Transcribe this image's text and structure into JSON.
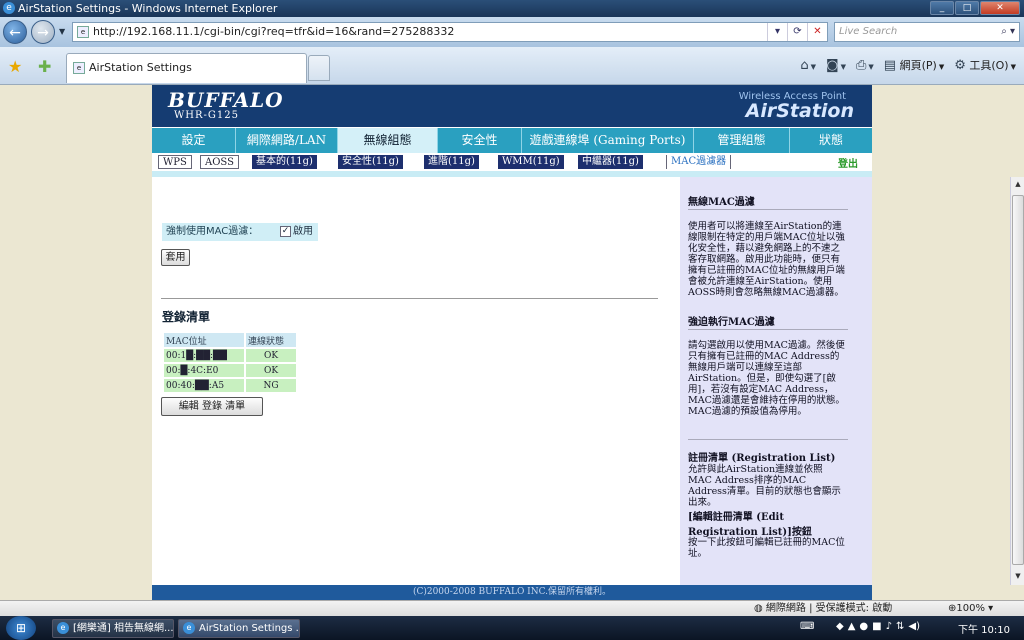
{
  "window": {
    "title": "AirStation Settings - Windows Internet Explorer"
  },
  "address": {
    "url": "http://192.168.11.1/cgi-bin/cgi?req=tfr&id=16&rand=275288332",
    "search_placeholder": "Live Search"
  },
  "tab": {
    "label": "AirStation Settings"
  },
  "cmd": {
    "page": "網頁(P)",
    "tools": "工具(O)"
  },
  "brand": {
    "logo": "BUFFALO",
    "model": "WHR-G125",
    "subtitle": "Wireless Access Point",
    "product": "AirStation"
  },
  "mainnav": [
    "設定",
    "網際網路/LAN",
    "無線組態",
    "安全性",
    "遊戲連線埠 (Gaming Ports)",
    "管理組態",
    "狀態"
  ],
  "subnav": [
    "WPS",
    "AOSS",
    "基本的(11g)",
    "安全性(11g)",
    "進階(11g)",
    "WMM(11g)",
    "中繼器(11g)",
    "MAC過濾器"
  ],
  "logout": "登出",
  "enforce": {
    "label": "強制使用MAC過濾：",
    "checkbox": "啟用"
  },
  "apply": "套用",
  "registration": {
    "title": "登錄清單",
    "headers": [
      "MAC位址",
      "連線狀態"
    ],
    "rows": [
      [
        "00:1█:██:██",
        "OK"
      ],
      [
        "00:█:4C:E0",
        "OK"
      ],
      [
        "00:40:██:A5",
        "NG"
      ]
    ],
    "edit": "編輯 登錄 清單"
  },
  "help": {
    "h1": "無線MAC過濾",
    "p1": "使用者可以將連線至AirStation的連線限制在特定的用戶端MAC位址以強化安全性，藉以避免網路上的不速之客存取網路。啟用此功能時，便只有擁有已註冊的MAC位址的無線用戶端會被允許連線至AirStation。使用AOSS時則會忽略無線MAC過濾器。",
    "h2": "強迫執行MAC過濾",
    "p2": "請勾選啟用以使用MAC過濾。然後便只有擁有已註冊的MAC Address的無線用戶端可以連線至這部AirStation。但是，即使勾選了[啟用]，若沒有設定MAC Address，MAC過濾還是會維持在停用的狀態。MAC過濾的預設值為停用。",
    "h3": "註冊清單 (Registration List)",
    "p3": "允許與此AirStation連線並依照MAC Address排序的MAC Address清單。目前的狀態也會顯示出來。",
    "h4": "[編輯註冊清單 (Edit Registration List)]按鈕",
    "p4": "按一下此按鈕可編輯已註冊的MAC位址。"
  },
  "footer": "(C)2000-2008 BUFFALO INC.保留所有權利。",
  "status": {
    "zone": "網際網路 | 受保護模式: 啟動",
    "zoom": "100%"
  },
  "taskbar": {
    "btn1": "[網樂通] 相告無線網...",
    "btn2": "AirStation Settings ...",
    "clock": "下午 10:10"
  }
}
